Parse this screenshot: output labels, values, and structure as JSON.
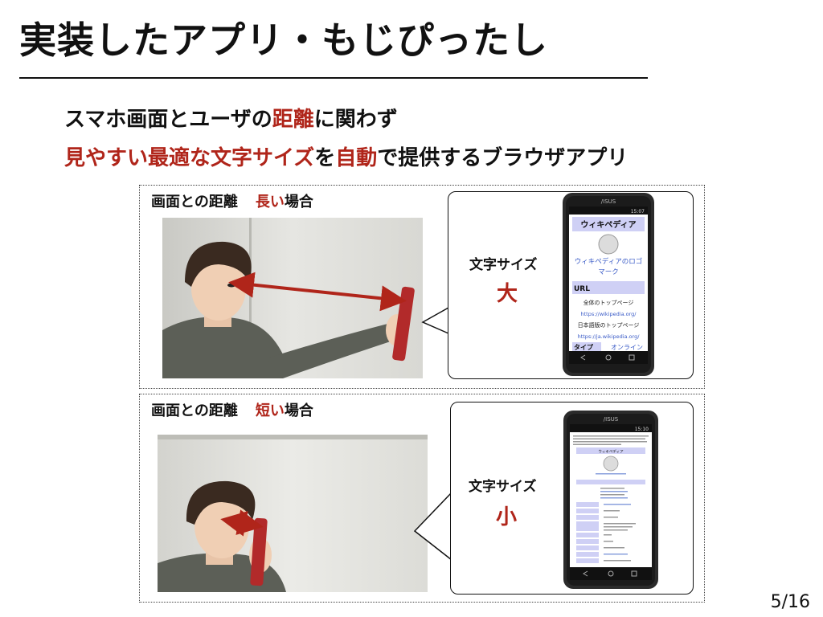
{
  "slide": {
    "title": "実装したアプリ・もじぴったし",
    "subtitle_line1": {
      "part1": "スマホ画面とユーザの",
      "highlight": "距離",
      "part2": "に関わず"
    },
    "subtitle_line2": {
      "highlight1": "見やすい最適な文字サイズ",
      "part1": "を",
      "highlight2": "自動",
      "part2": "で提供するブラウザアプリ"
    },
    "page_number": "5/16"
  },
  "panel_long": {
    "caption": "画面との距離",
    "caption_highlight": "長い",
    "caption_suffix": "場合",
    "size_label": "文字サイズ",
    "size_value": "大",
    "phone": {
      "brand": "/ISUS",
      "status_time": "15:07",
      "header": "ウィキペディア",
      "logo_caption_1": "ウィキペディアのロゴ",
      "logo_caption_2": "マーク",
      "section_url": "URL",
      "row1": "全体のトップページ",
      "link1": "https://wikipedia.org/",
      "row2": "日本語版のトップページ",
      "link2": "https://ja.wikipedia.org/",
      "row_type": "タイプ",
      "row_type_value": "オンライン"
    }
  },
  "panel_short": {
    "caption": "画面との距離",
    "caption_highlight": "短い",
    "caption_suffix": "場合",
    "size_label": "文字サイズ",
    "size_value": "小",
    "phone": {
      "brand": "/ISUS",
      "status_time": "15:10",
      "header": "ウィキペディア"
    }
  },
  "colors": {
    "accent_red": "#b0251a",
    "wiki_header": "#cfd0f5",
    "link_blue": "#3a5bc7"
  }
}
